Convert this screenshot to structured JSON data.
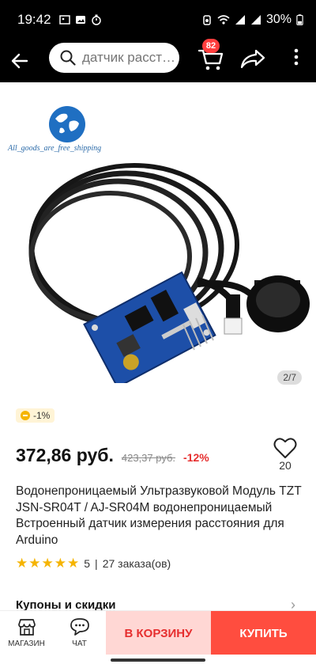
{
  "status_bar": {
    "time": "19:42",
    "battery": "30%",
    "icons_left": [
      "image-icon",
      "photo-icon",
      "timer-icon"
    ],
    "icons_right": [
      "alarm-icon",
      "wifi-icon",
      "signal-icon",
      "signal-icon",
      "battery-icon"
    ]
  },
  "nav": {
    "search_placeholder": "датчик расст…",
    "cart_count": "82"
  },
  "product": {
    "image_watermark": "All_goods_are_free_shipping",
    "page_indicator": "2/7",
    "coin_discount": "-1%",
    "price": "372,86 руб.",
    "old_price": "423,37 руб.",
    "discount": "-12%",
    "wish_count": "20",
    "title": "Водонепроницаемый Ультразвуковой Модуль TZT JSN-SR04T / AJ-SR04M водонепроницаемый Встроенный датчик измерения расстояния для Arduino",
    "rating": "5",
    "orders": "27 заказа(ов)",
    "rating_separator": "|",
    "stars": 5
  },
  "coupons": {
    "label": "Купоны и скидки"
  },
  "bottom_bar": {
    "store_label": "МАГАЗИН",
    "chat_label": "ЧАТ",
    "add_to_cart_label": "В КОРЗИНУ",
    "buy_label": "КУПИТЬ"
  },
  "colors": {
    "accent": "#ff4d3f",
    "accent_light": "#ffd7d4",
    "price_discount": "#e62e2e",
    "star": "#f5b400"
  }
}
